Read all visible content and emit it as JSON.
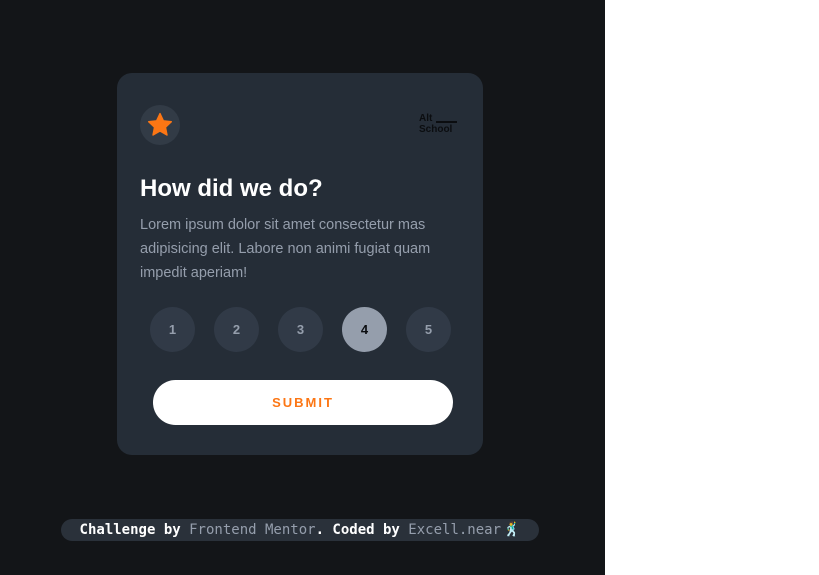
{
  "card": {
    "star_icon": "star-icon",
    "logo": {
      "line1": "Alt",
      "line2": "School"
    },
    "title": "How did we do?",
    "description": "Lorem ipsum dolor sit amet consectetur mas adipisicing elit. Labore non animi fugiat quam impedit aperiam!",
    "ratings": [
      "1",
      "2",
      "3",
      "4",
      "5"
    ],
    "selected_rating": "4",
    "submit_label": "SUBMIT"
  },
  "attribution": {
    "prefix": "Challenge by",
    "challenge_link": "Frontend Mentor",
    "middle": ". Coded by",
    "author_link": "Excell.near",
    "emoji": "🕺"
  },
  "colors": {
    "page_background": "#131518",
    "card_background": "#252d37",
    "accent_orange": "#fc7614",
    "muted_text": "#959eac",
    "selected_rating_bg": "#959eac"
  }
}
